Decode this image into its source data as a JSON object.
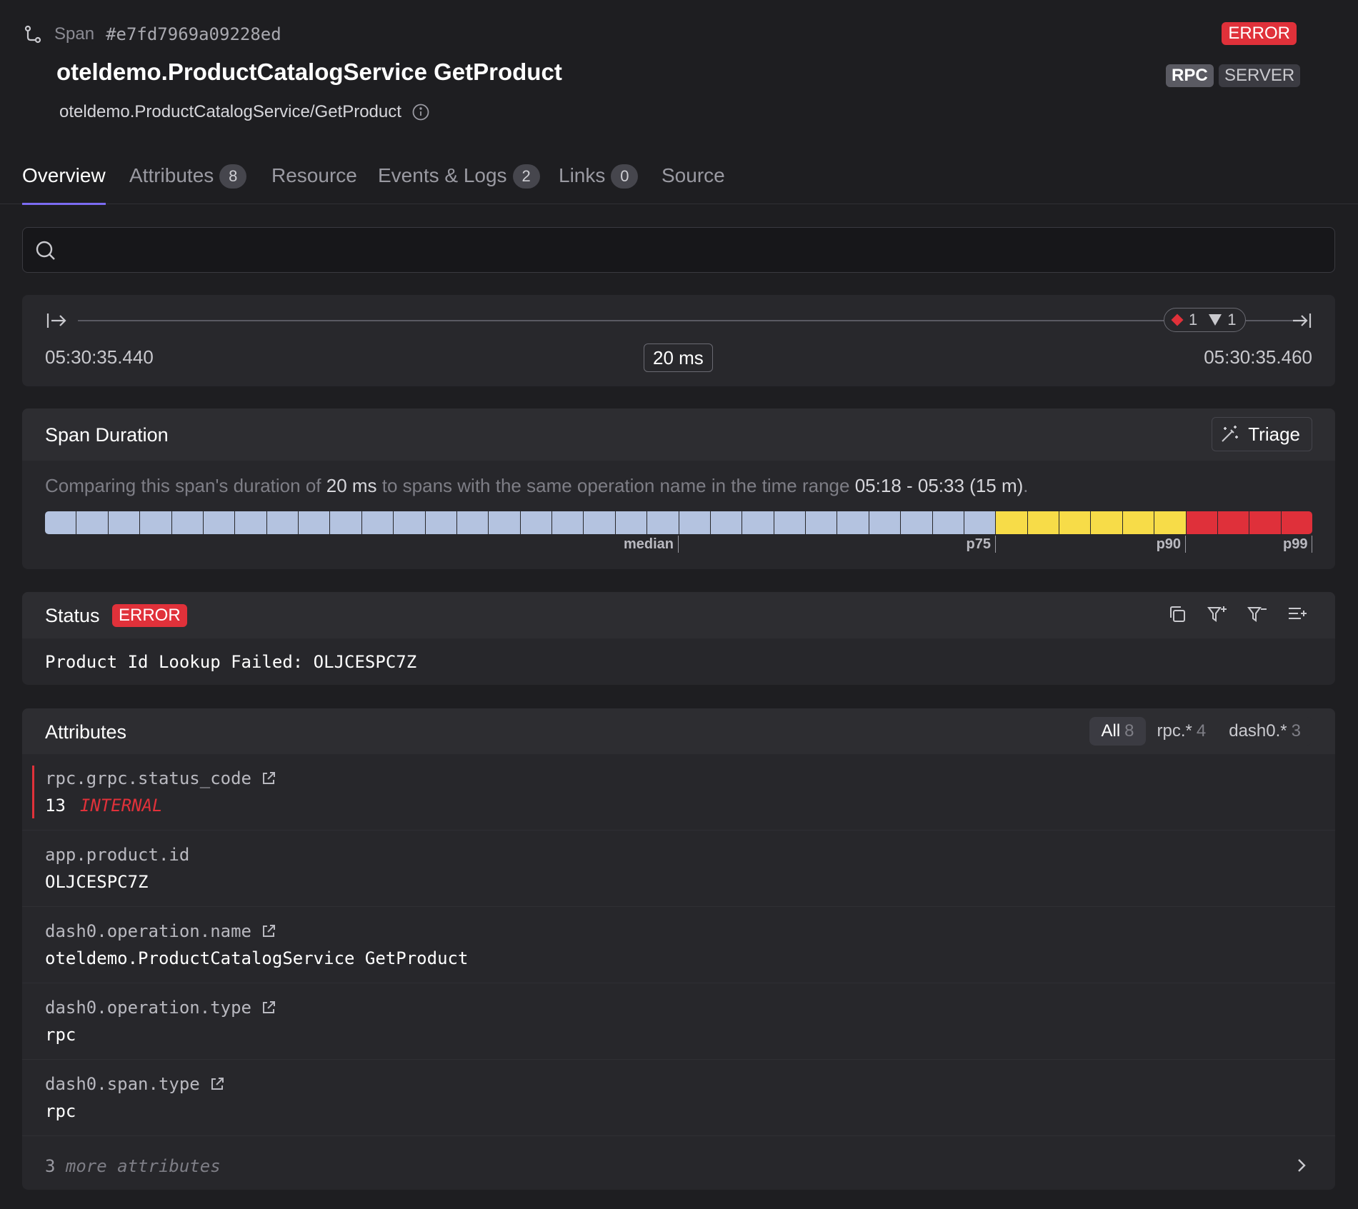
{
  "header": {
    "span_label": "Span",
    "span_id": "#e7fd7969a09228ed",
    "status_badge": "ERROR",
    "title": "oteldemo.ProductCatalogService GetProduct",
    "tags": [
      "RPC",
      "SERVER"
    ],
    "subtitle": "oteldemo.ProductCatalogService/GetProduct"
  },
  "tabs": [
    {
      "label": "Overview",
      "count": null,
      "active": true
    },
    {
      "label": "Attributes",
      "count": "8"
    },
    {
      "label": "Resource",
      "count": null
    },
    {
      "label": "Events & Logs",
      "count": "2"
    },
    {
      "label": "Links",
      "count": "0"
    },
    {
      "label": "Source",
      "count": null
    }
  ],
  "search": {
    "placeholder": "",
    "value": ""
  },
  "timeline": {
    "start": "05:30:35.440",
    "end": "05:30:35.460",
    "duration": "20 ms",
    "error_markers": "1",
    "event_markers": "1"
  },
  "span_duration": {
    "title": "Span Duration",
    "triage_label": "Triage",
    "cmp_prefix": "Comparing this span's duration of ",
    "cmp_duration": "20 ms",
    "cmp_middle": " to spans with the same operation name in the time range ",
    "cmp_range": "05:18 - 05:33 (15 m)",
    "cmp_suffix": ".",
    "histogram": {
      "bucket_count": 40,
      "color_normal": "#b4c3e0",
      "color_p75": "#f7dc48",
      "color_p90": "#df303a",
      "p75_from": 30,
      "p90_from": 36
    },
    "percentiles": [
      {
        "label": "median",
        "bucket": 20
      },
      {
        "label": "p75",
        "bucket": 30
      },
      {
        "label": "p90",
        "bucket": 36
      },
      {
        "label": "p99",
        "bucket": 40
      }
    ]
  },
  "status": {
    "title": "Status",
    "badge": "ERROR",
    "message": "Product Id Lookup Failed: OLJCESPC7Z",
    "actions": [
      "copy-icon",
      "filter-add-icon",
      "filter-remove-icon",
      "add-to-list-icon"
    ]
  },
  "attributes": {
    "title": "Attributes",
    "filters": [
      {
        "label": "All",
        "count": "8",
        "active": true
      },
      {
        "label": "rpc.*",
        "count": "4"
      },
      {
        "label": "dash0.*",
        "count": "3"
      }
    ],
    "rows": [
      {
        "key": "rpc.grpc.status_code",
        "value": "13",
        "value_extra": "INTERNAL",
        "link": true,
        "error": true
      },
      {
        "key": "app.product.id",
        "value": "OLJCESPC7Z",
        "link": false
      },
      {
        "key": "dash0.operation.name",
        "value": "oteldemo.ProductCatalogService GetProduct",
        "link": true
      },
      {
        "key": "dash0.operation.type",
        "value": "rpc",
        "link": true
      },
      {
        "key": "dash0.span.type",
        "value": "rpc",
        "link": true
      }
    ],
    "more_count": "3",
    "more_label": "more attributes"
  }
}
